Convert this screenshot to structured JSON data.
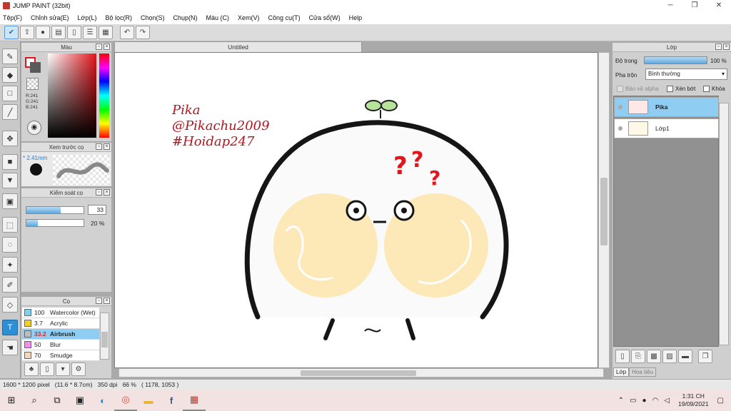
{
  "window": {
    "title": "JUMP PAINT (32bit)",
    "minimize": "─",
    "restore": "❐",
    "close": "✕"
  },
  "menu": [
    "Tệp(F)",
    "Chỉnh sửa(E)",
    "Lớp(L)",
    "Bộ lọc(R)",
    "Chọn(S)",
    "Chụp(N)",
    "Màu (C)",
    "Xem(V)",
    "Công cụ(T)",
    "Cửa sổ(W)",
    "Help"
  ],
  "toolbar": {
    "icons": [
      "check-icon",
      "export-icon",
      "comment-icon",
      "message-icon",
      "page-icon",
      "layout-icon",
      "grid-icon",
      "undo-icon",
      "redo-icon"
    ]
  },
  "tools": [
    "brush-icon",
    "eraser-icon",
    "rectangle-icon",
    "pen-icon",
    "move-icon",
    "fill-rect-icon",
    "bucket-icon",
    "gradient-icon",
    "select-rect-icon",
    "lasso-icon",
    "magic-wand-icon",
    "select-pen-icon",
    "select-eraser-icon",
    "text-icon",
    "hand-icon"
  ],
  "panels": {
    "color": {
      "title": "Màu",
      "r": "R:241",
      "g": "G:241",
      "b": "B:241",
      "primary": "#e3141b"
    },
    "brush_preview": {
      "title": "Xem trước cọ",
      "size": "* 2.41mm"
    },
    "brush_control": {
      "title": "Kiểm soát cọ",
      "size_value": "33",
      "opacity_value": "20 %",
      "size_fill": 0.6,
      "opacity_fill": 0.2
    },
    "brush": {
      "title": "Cọ",
      "items": [
        {
          "size": "100",
          "name": "Watercolor (Wet)",
          "color": "#7fd3f2"
        },
        {
          "size": "3.7",
          "name": "Acrylic",
          "color": "#f2d21c"
        },
        {
          "size": "33.2",
          "name": "Airbrush",
          "color": "#bdbdbd"
        },
        {
          "size": "50",
          "name": "Blur",
          "color": "#f18ef0"
        },
        {
          "size": "70",
          "name": "Smudge",
          "color": "#f4d6b8"
        }
      ]
    },
    "layer": {
      "title": "Lớp",
      "opacity_label": "Độ trong",
      "opacity_value": "100 %",
      "blend_label": "Pha trộn",
      "blend_value": "Bình thường",
      "protect_alpha": "Bảo vệ alpha",
      "clipping": "Xén bớt",
      "lock": "Khóa",
      "layers": [
        {
          "name": "Pika"
        },
        {
          "name": "Lớp1"
        }
      ],
      "tab_layer": "Lớp",
      "tab_note": "Hoa tiêu"
    }
  },
  "document": {
    "tab": "Untitled",
    "watermark": [
      "Pika",
      "@Pikachu2009",
      "#Hoidap247"
    ],
    "watermark_color": "#b5141c"
  },
  "status": {
    "text": "1600 * 1200 pixel   (11.6 * 8.7cm)   350 dpi   66 %   ( 1178, 1053 )"
  },
  "taskbar": {
    "apps": [
      "windows-icon",
      "search-icon",
      "task-view-icon",
      "store-icon",
      "edge-icon",
      "chrome-icon",
      "folder-icon",
      "facebook-icon",
      "jump-paint-icon"
    ],
    "time": "1:31 CH",
    "date": "19/09/2021"
  }
}
